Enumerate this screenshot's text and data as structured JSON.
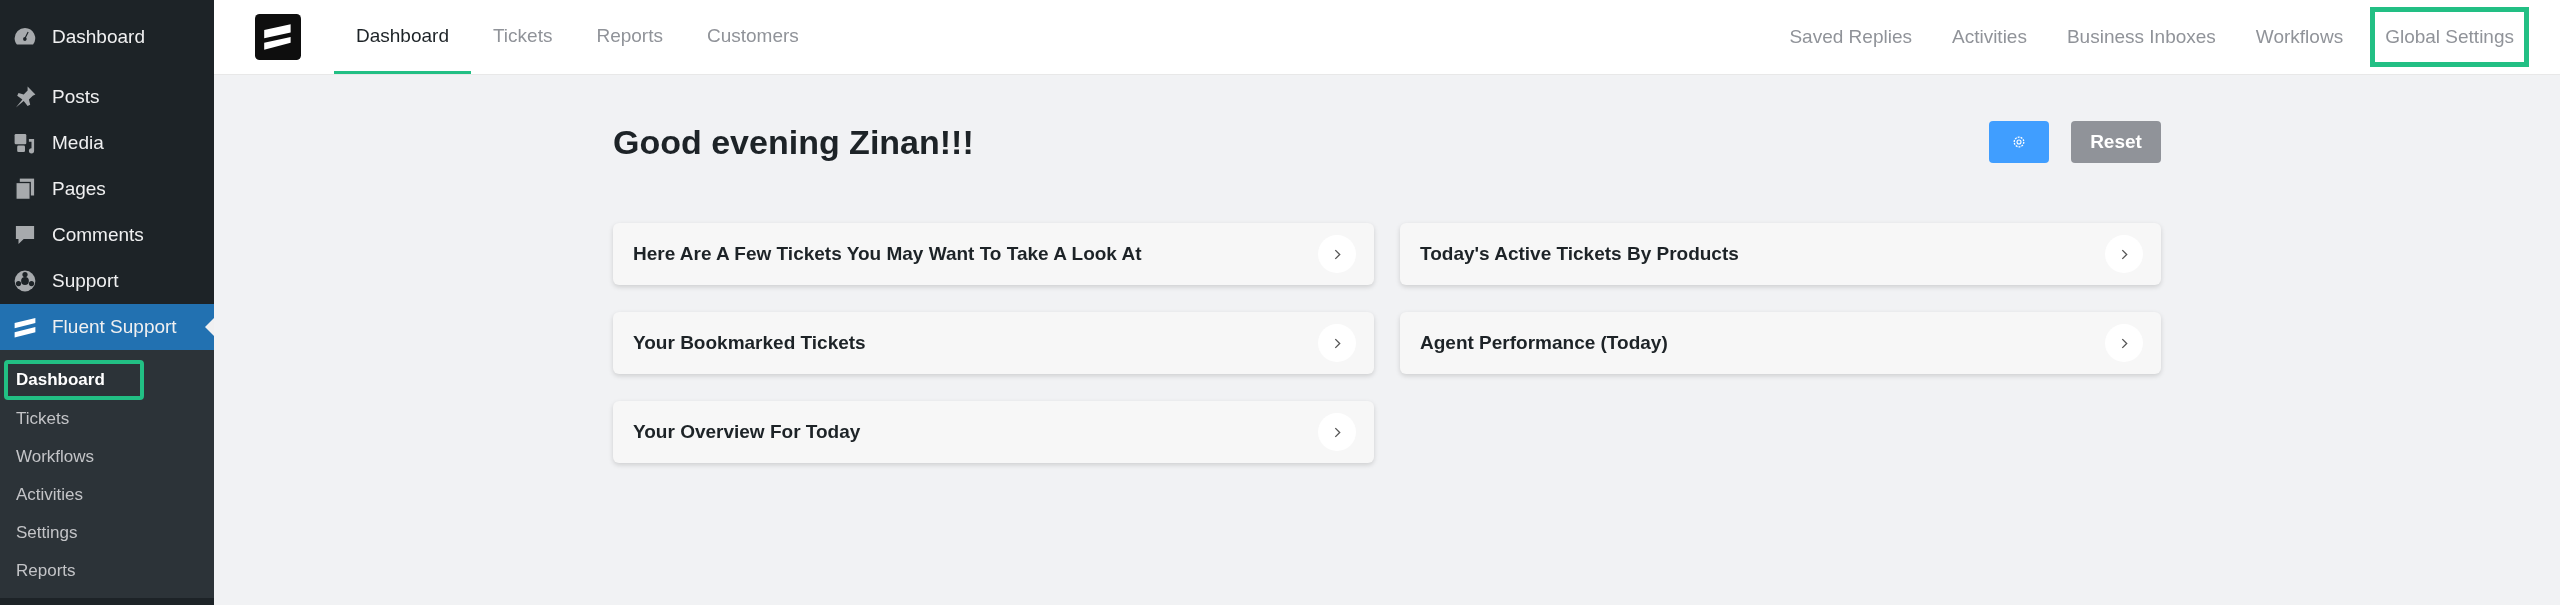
{
  "sidebar": {
    "items": [
      {
        "label": "Dashboard",
        "selected": false
      },
      {
        "label": "Posts",
        "selected": false
      },
      {
        "label": "Media",
        "selected": false
      },
      {
        "label": "Pages",
        "selected": false
      },
      {
        "label": "Comments",
        "selected": false
      },
      {
        "label": "Support",
        "selected": false
      },
      {
        "label": "Fluent Support",
        "selected": true
      }
    ],
    "submenu": [
      {
        "label": "Dashboard",
        "selected": true,
        "highlighted": true
      },
      {
        "label": "Tickets",
        "selected": false,
        "highlighted": false
      },
      {
        "label": "Workflows",
        "selected": false,
        "highlighted": false
      },
      {
        "label": "Activities",
        "selected": false,
        "highlighted": false
      },
      {
        "label": "Settings",
        "selected": false,
        "highlighted": false
      },
      {
        "label": "Reports",
        "selected": false,
        "highlighted": false
      }
    ]
  },
  "top_nav": {
    "left_tabs": [
      {
        "label": "Dashboard",
        "selected": true
      },
      {
        "label": "Tickets",
        "selected": false
      },
      {
        "label": "Reports",
        "selected": false
      },
      {
        "label": "Customers",
        "selected": false
      }
    ],
    "right_tabs": [
      {
        "label": "Saved Replies",
        "highlighted": false
      },
      {
        "label": "Activities",
        "highlighted": false
      },
      {
        "label": "Business Inboxes",
        "highlighted": false
      },
      {
        "label": "Workflows",
        "highlighted": false
      },
      {
        "label": "Global Settings",
        "highlighted": true
      }
    ]
  },
  "greeting": "Good evening Zinan!!!",
  "buttons": {
    "reset": "Reset"
  },
  "cards": [
    {
      "title": "Here Are A Few Tickets You May Want To Take A Look At"
    },
    {
      "title": "Today's Active Tickets By Products"
    },
    {
      "title": "Your Bookmarked Tickets"
    },
    {
      "title": "Agent Performance (Today)"
    },
    {
      "title": "Your Overview For Today"
    }
  ]
}
